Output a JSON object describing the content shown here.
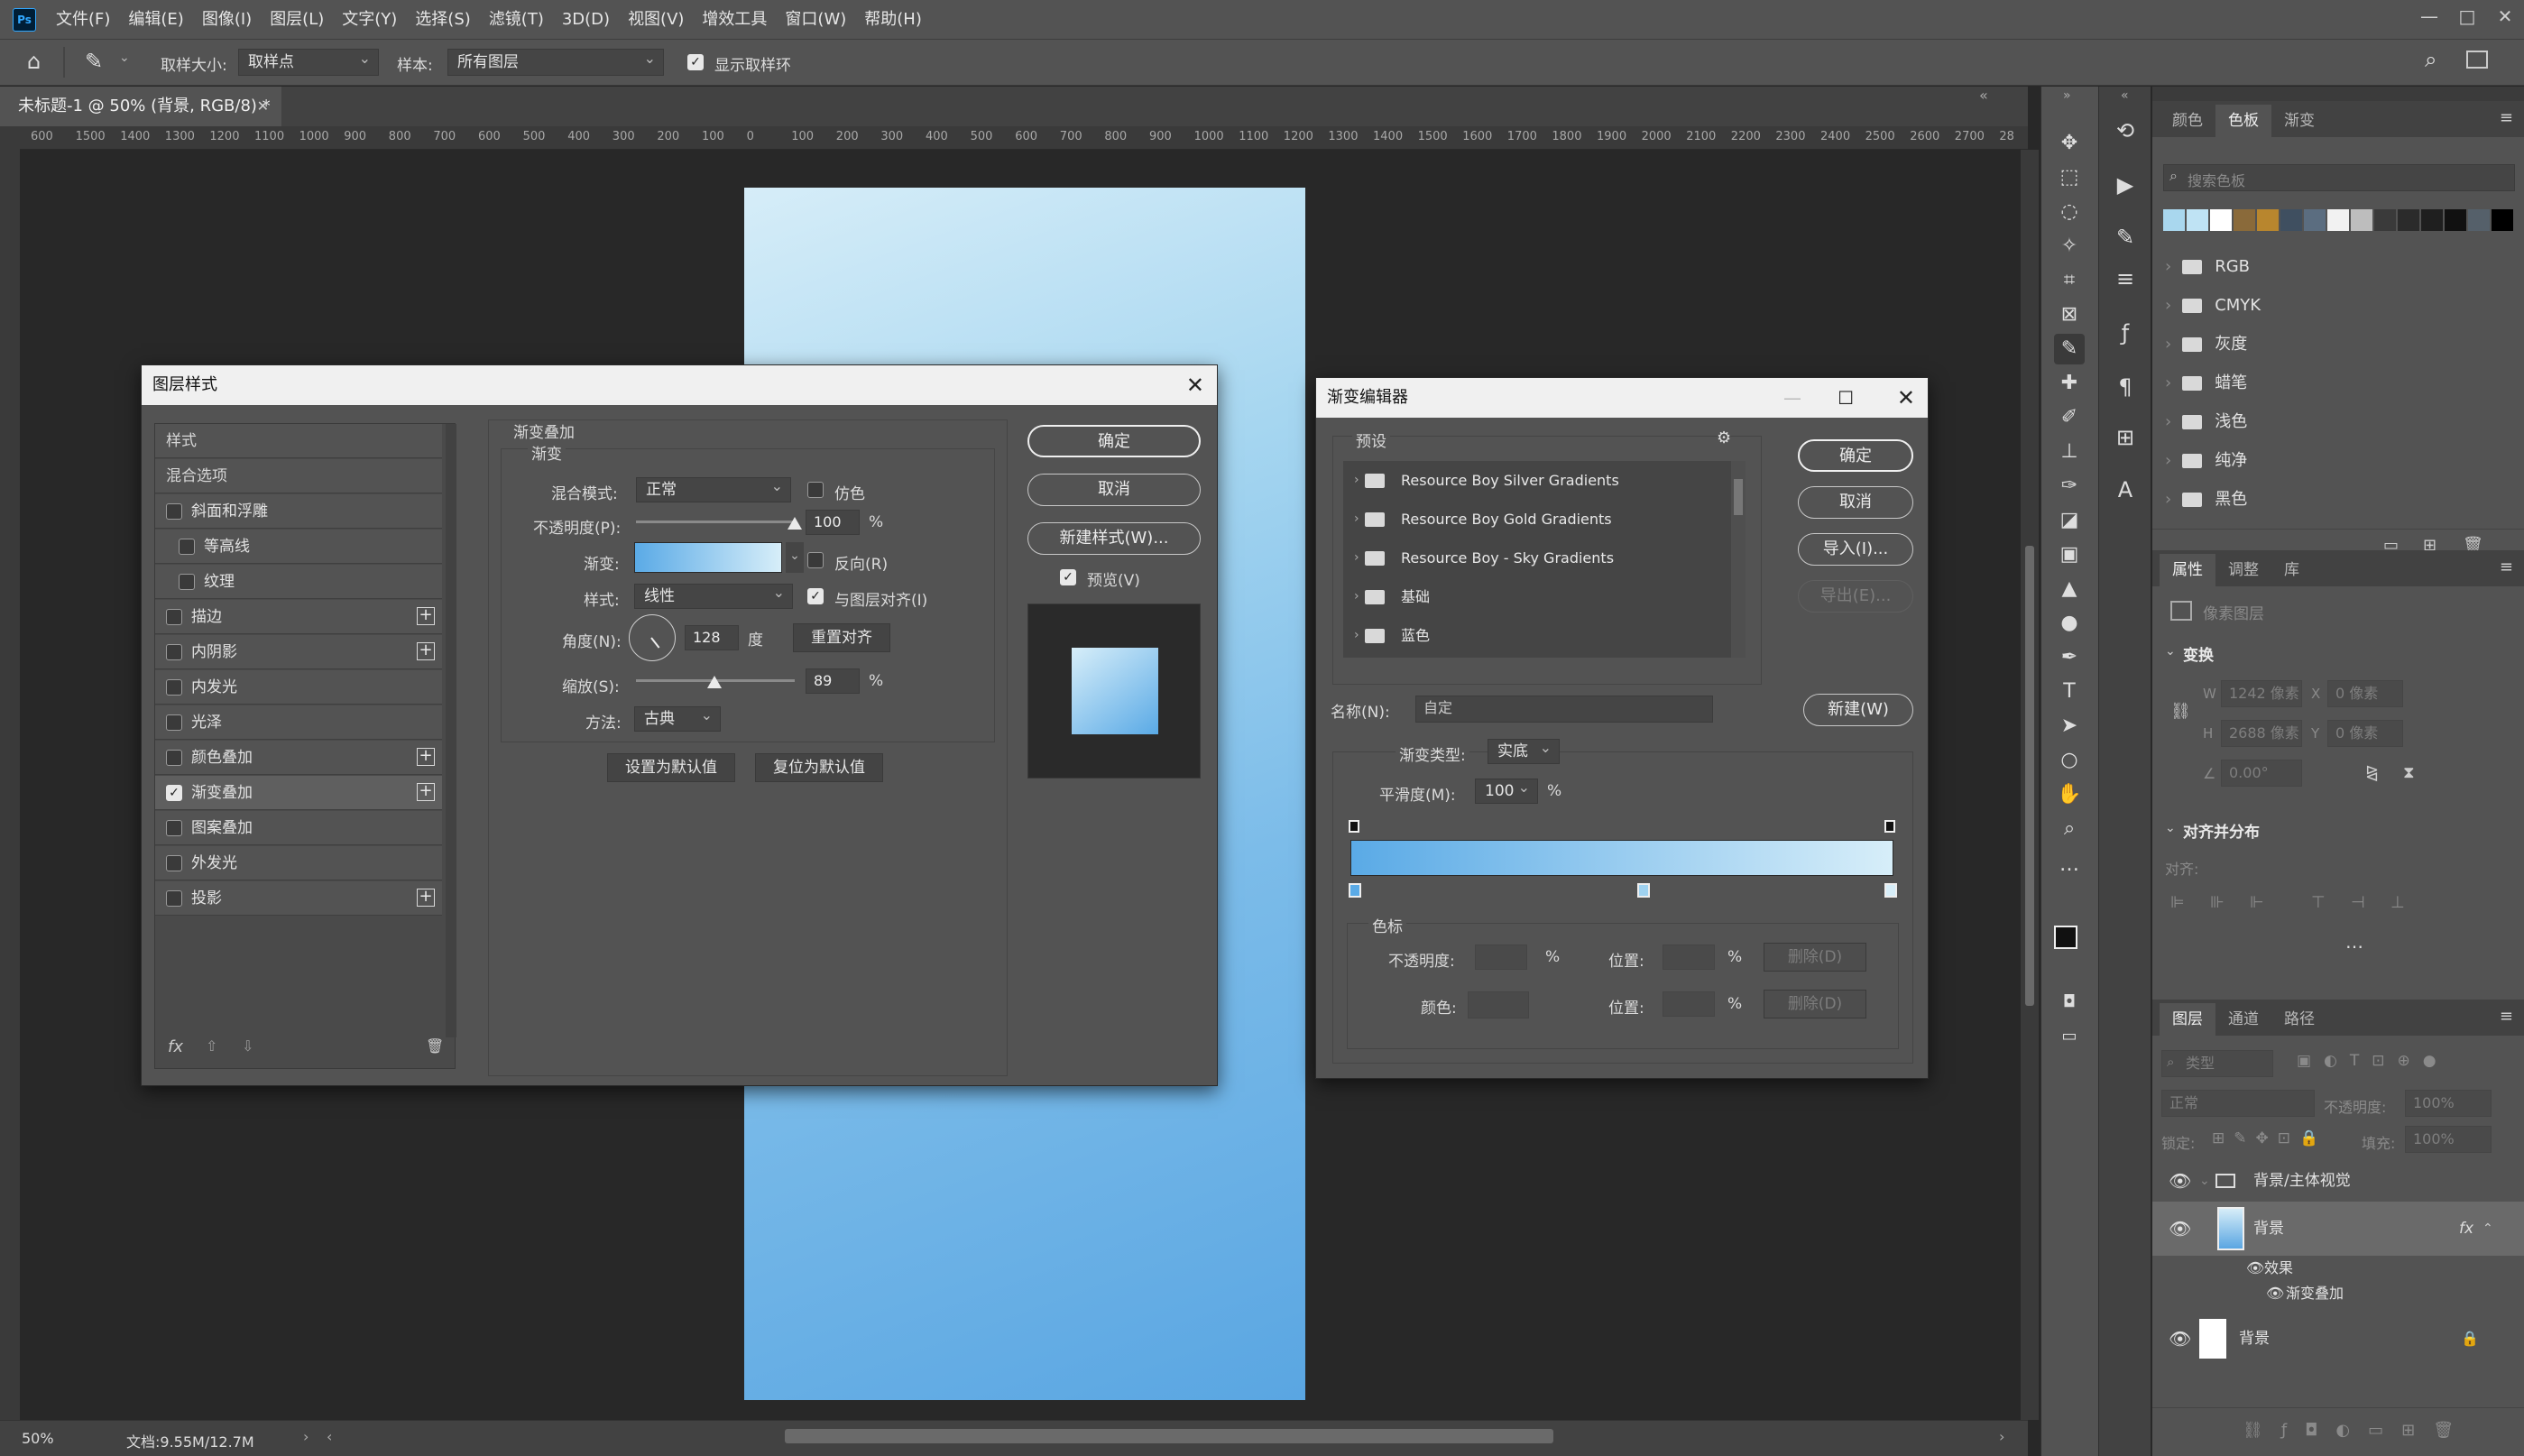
{
  "menubar": {
    "items": [
      "文件(F)",
      "编辑(E)",
      "图像(I)",
      "图层(L)",
      "文字(Y)",
      "选择(S)",
      "滤镜(T)",
      "3D(D)",
      "视图(V)",
      "增效工具",
      "窗口(W)",
      "帮助(H)"
    ],
    "logo": "Ps",
    "controls": [
      "—",
      "□",
      "✕"
    ]
  },
  "options": {
    "sample_size_label": "取样大小:",
    "sample_size_value": "取样点",
    "sample_label": "样本:",
    "sample_value": "所有图层",
    "show_ring_label": "显示取样环",
    "show_ring_checked": true
  },
  "document": {
    "tab_title": "未标题-1 @ 50% (背景, RGB/8) *",
    "zoom": "50%",
    "doc_info": "文档:9.55M/12.7M"
  },
  "ruler": {
    "ticks": [
      "600",
      "1500",
      "1400",
      "1300",
      "1200",
      "1100",
      "1000",
      "900",
      "800",
      "700",
      "600",
      "500",
      "400",
      "300",
      "200",
      "100",
      "0",
      "100",
      "200",
      "300",
      "400",
      "500",
      "600",
      "700",
      "800",
      "900",
      "1000",
      "1100",
      "1200",
      "1300",
      "1400",
      "1500",
      "1600",
      "1700",
      "1800",
      "1900",
      "2000",
      "2100",
      "2200",
      "2300",
      "2400",
      "2500",
      "2600",
      "2700",
      "28"
    ]
  },
  "swatches_panel": {
    "tabs": [
      "颜色",
      "色板",
      "渐变"
    ],
    "search_placeholder": "搜索色板",
    "colors": [
      "#a9d7ee",
      "#bfe3f4",
      "#ffffff",
      "#8a6a3a",
      "#b8862e",
      "#3f4f60",
      "#5b6d80",
      "#f2f2f2",
      "#bdbdbd",
      "#3a3a3a",
      "#2b2b2b",
      "#1f1f1f",
      "#111111",
      "#55606a",
      "#000000"
    ],
    "folders": [
      "RGB",
      "CMYK",
      "灰度",
      "蜡笔",
      "浅色",
      "纯净",
      "黑色"
    ]
  },
  "properties_panel": {
    "tabs": [
      "属性",
      "调整",
      "库"
    ],
    "pixel_layer": "像素图层",
    "transform": "变换",
    "w_label": "W",
    "w_value": "1242 像素",
    "x_label": "X",
    "x_value": "0 像素",
    "h_label": "H",
    "h_value": "2688 像素",
    "y_label": "Y",
    "y_value": "0 像素",
    "angle": "0.00°",
    "align_section": "对齐并分布",
    "align_label": "对齐:"
  },
  "layers_panel": {
    "tabs": [
      "图层",
      "通道",
      "路径"
    ],
    "filter_placeholder": "类型",
    "blend": "正常",
    "opacity_label": "不透明度:",
    "opacity_value": "100%",
    "lock_label": "锁定:",
    "fill_label": "填充:",
    "fill_value": "100%",
    "group_name": "背景/主体视觉",
    "layer1_name": "背景",
    "effects_label": "效果",
    "effect_name": "渐变叠加",
    "layer2_name": "背景"
  },
  "layer_style": {
    "title": "图层样式",
    "list_header": "样式",
    "blend_options": "混合选项",
    "items": [
      {
        "label": "斜面和浮雕",
        "checked": false,
        "plus": false,
        "indent": false
      },
      {
        "label": "等高线",
        "checked": false,
        "plus": false,
        "indent": true
      },
      {
        "label": "纹理",
        "checked": false,
        "plus": false,
        "indent": true
      },
      {
        "label": "描边",
        "checked": false,
        "plus": true,
        "indent": false
      },
      {
        "label": "内阴影",
        "checked": false,
        "plus": true,
        "indent": false
      },
      {
        "label": "内发光",
        "checked": false,
        "plus": false,
        "indent": false
      },
      {
        "label": "光泽",
        "checked": false,
        "plus": false,
        "indent": false
      },
      {
        "label": "颜色叠加",
        "checked": false,
        "plus": true,
        "indent": false
      },
      {
        "label": "渐变叠加",
        "checked": true,
        "plus": true,
        "indent": false
      },
      {
        "label": "图案叠加",
        "checked": false,
        "plus": false,
        "indent": false
      },
      {
        "label": "外发光",
        "checked": false,
        "plus": false,
        "indent": false
      },
      {
        "label": "投影",
        "checked": false,
        "plus": true,
        "indent": false
      }
    ],
    "section_title": "渐变叠加",
    "group_title": "渐变",
    "blend_mode_label": "混合模式:",
    "blend_mode_value": "正常",
    "dither_label": "仿色",
    "opacity_label": "不透明度(P):",
    "opacity_value": "100",
    "opacity_pct": 1.0,
    "gradient_label": "渐变:",
    "reverse_label": "反向(R)",
    "style_label": "样式:",
    "style_value": "线性",
    "align_layer_label": "与图层对齐(I)",
    "angle_label": "角度(N):",
    "angle_value": "128",
    "angle_unit": "度",
    "reset_align": "重置对齐",
    "scale_label": "缩放(S):",
    "scale_value": "89",
    "scale_pct": 0.89,
    "method_label": "方法:",
    "method_value": "古典",
    "set_default": "设置为默认值",
    "reset_default": "复位为默认值",
    "ok": "确定",
    "cancel": "取消",
    "new_style": "新建样式(W)...",
    "preview_label": "预览(V)",
    "percent": "%"
  },
  "gradient_editor": {
    "title": "渐变编辑器",
    "presets_label": "预设",
    "presets": [
      "Resource Boy Silver Gradients",
      "Resource Boy Gold Gradients",
      "Resource Boy - Sky Gradients",
      "基础",
      "蓝色"
    ],
    "ok": "确定",
    "cancel": "取消",
    "import": "导入(I)...",
    "export": "导出(E)...",
    "name_label": "名称(N):",
    "name_value": "自定",
    "new": "新建(W)",
    "type_label": "渐变类型:",
    "type_value": "实底",
    "smooth_label": "平滑度(M):",
    "smooth_value": "100",
    "stops_label": "色标",
    "opacity_label": "不透明度:",
    "location_label": "位置:",
    "color_label": "颜色:",
    "delete": "删除(D)",
    "percent": "%",
    "gradient_start": "#5aaae6",
    "gradient_end": "#d7eef9"
  }
}
